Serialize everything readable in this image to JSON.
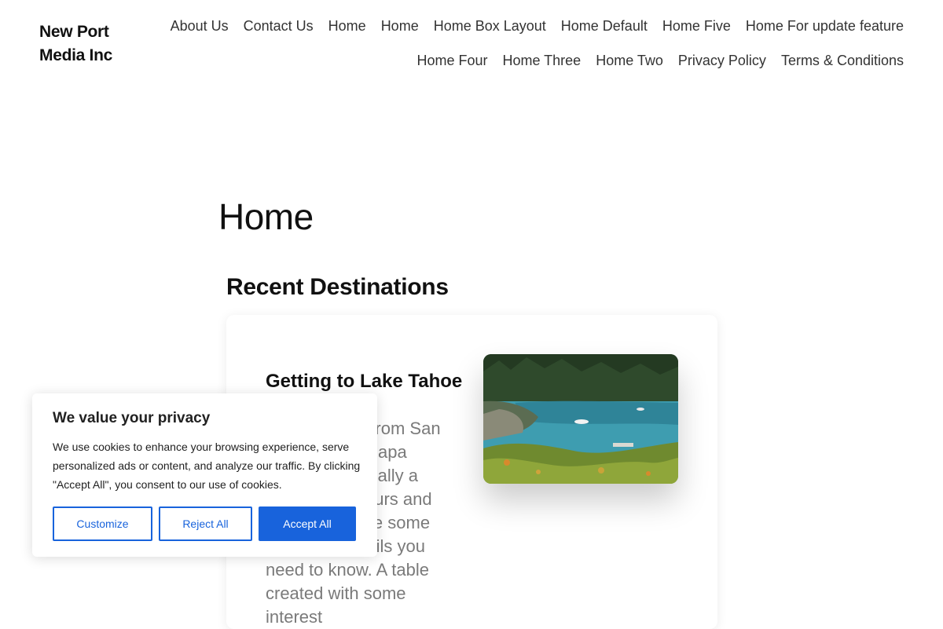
{
  "header": {
    "site_title": "New Port Media Inc",
    "nav": [
      "About Us",
      "Contact Us",
      "Home",
      "Home",
      "Home Box Layout",
      "Home Default",
      "Home Five",
      "Home For update feature",
      "Home Four",
      "Home Three",
      "Home Two",
      "Privacy Policy",
      "Terms & Conditions"
    ]
  },
  "main": {
    "page_title": "Home",
    "section_heading": "Recent Destinations",
    "post": {
      "title": "Getting to Lake Tahoe",
      "excerpt": "Getting there from San Francisco or Napa Valley is not really a question of hours and miles. Here are some important details you need to know. A table created with some interest"
    }
  },
  "cookie_banner": {
    "title": "We value your privacy",
    "text": "We use cookies to enhance your browsing experience, serve personalized ads or content, and analyze our traffic. By clicking \"Accept All\", you consent to our use of cookies.",
    "customize_label": "Customize",
    "reject_label": "Reject All",
    "accept_label": "Accept All"
  },
  "colors": {
    "accent": "#1863dc",
    "text": "#111111",
    "muted_text": "#7a7a7a"
  }
}
